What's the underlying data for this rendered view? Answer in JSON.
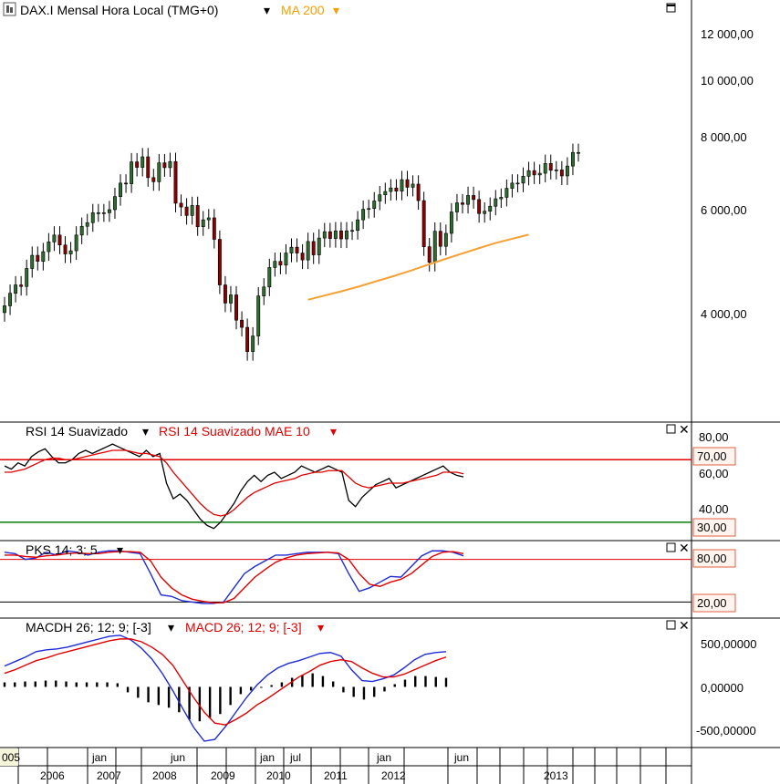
{
  "colors": {
    "up": "#2e6b2e",
    "down": "#8b0000",
    "ma": "#f5a033",
    "rsi": "#000000",
    "rsi_mae": "#e00000",
    "pks_k": "#1f2bd6",
    "pks_d": "#e00000",
    "macd": "#1f2bd6",
    "signal": "#e00000",
    "level_upper": "#e00000",
    "level_lower": "#0a7a0a"
  },
  "panels": {
    "price": {
      "title": "DAX.I Mensal Hora Local (TMG+0)",
      "overlay": "MA 200",
      "yticks": [
        "12 000,00",
        "10 000,00",
        "8 000,00",
        "6 000,00",
        "4 000,00"
      ]
    },
    "rsi": {
      "title": "RSI 14 Suavizado",
      "overlay": "RSI 14 Suavizado MAE 10",
      "yticks": [
        "80,00",
        "60,00",
        "40,00"
      ],
      "levels": [
        "70,00",
        "30,00"
      ]
    },
    "pks": {
      "title": "PKS 14; 3; 5",
      "levels": [
        "80,00",
        "20,00"
      ]
    },
    "macd": {
      "title": "MACDH 26; 12; 9; [-3]",
      "overlay": "MACD 26; 12; 9; [-3]",
      "yticks": [
        "500,00000",
        "0,00000",
        "-500,00000"
      ]
    }
  },
  "xaxis": {
    "top_labels": [
      "005",
      "jan",
      "jun",
      "jan",
      "jul",
      "jan",
      "jun"
    ],
    "years": [
      "2006",
      "2007",
      "2008",
      "2009",
      "2010",
      "2011",
      "2012",
      "2013"
    ]
  },
  "chart_data": [
    {
      "type": "candlestick",
      "title": "DAX.I Mensal Hora Local (TMG+0)",
      "scale": "log",
      "ylim": [
        3000,
        14000
      ],
      "x_range": [
        "2005-06",
        "2013-05"
      ],
      "close": [
        4590,
        4820,
        4980,
        4950,
        5310,
        5590,
        5460,
        5670,
        5890,
        6050,
        5820,
        5620,
        5690,
        6050,
        6260,
        6350,
        6600,
        6600,
        6600,
        6680,
        7030,
        7410,
        7390,
        8050,
        7880,
        8210,
        7570,
        7450,
        8020,
        7870,
        8060,
        6850,
        6750,
        6530,
        6790,
        6250,
        6420,
        6470,
        5950,
        4980,
        4640,
        4790,
        4340,
        4220,
        3840,
        4080,
        4770,
        4940,
        5330,
        5460,
        5380,
        5640,
        5770,
        5640,
        5490,
        5900,
        5600,
        5980,
        6130,
        5970,
        6150,
        5960,
        6150,
        6160,
        6420,
        6690,
        6710,
        6910,
        7080,
        7170,
        7270,
        7180,
        7510,
        7290,
        7380,
        6920,
        5780,
        5440,
        6140,
        5790,
        6090,
        6620,
        6860,
        6820,
        7060,
        6950,
        6580,
        6640,
        6770,
        6970,
        7010,
        7260,
        7410,
        7410,
        7610,
        7780,
        7650,
        7700,
        8000,
        7790,
        7800,
        7620,
        7920,
        8350,
        8350
      ],
      "open": [
        4470,
        4590,
        4820,
        4980,
        4950,
        5310,
        5590,
        5460,
        5670,
        5890,
        6050,
        5820,
        5620,
        5690,
        6050,
        6260,
        6350,
        6600,
        6600,
        6600,
        6680,
        7030,
        7410,
        7390,
        8050,
        7880,
        8210,
        7570,
        7450,
        8020,
        7870,
        8060,
        6850,
        6750,
        6530,
        6790,
        6250,
        6420,
        6470,
        5950,
        4980,
        4640,
        4790,
        4340,
        4220,
        3840,
        4080,
        4770,
        4940,
        5330,
        5460,
        5380,
        5640,
        5770,
        5640,
        5490,
        5900,
        5600,
        5980,
        6130,
        5970,
        6150,
        5960,
        6150,
        6160,
        6420,
        6690,
        6710,
        6910,
        7080,
        7170,
        7270,
        7180,
        7510,
        7290,
        7380,
        6920,
        5780,
        5440,
        6140,
        5790,
        6090,
        6620,
        6860,
        6820,
        7060,
        6950,
        6580,
        6640,
        6770,
        6970,
        7010,
        7260,
        7410,
        7410,
        7610,
        7780,
        7650,
        7700,
        8000,
        7790,
        7800,
        7620,
        7920,
        8350
      ]
    },
    {
      "type": "line",
      "name": "MA 200",
      "x_range": [
        "2010-01",
        "2013-05"
      ],
      "values": [
        4700,
        4780,
        4860,
        4950,
        5050,
        5150,
        5260,
        5380,
        5500,
        5620,
        5740,
        5860,
        5960,
        6060
      ]
    },
    {
      "type": "line",
      "title": "RSI 14 Suavizado",
      "ylim": [
        20,
        90
      ],
      "levels": [
        70,
        30
      ],
      "series": [
        {
          "name": "RSI 14 Suavizado",
          "values": [
            66,
            64,
            68,
            66,
            72,
            75,
            77,
            72,
            68,
            68,
            70,
            74,
            76,
            74,
            76,
            78,
            80,
            78,
            76,
            74,
            72,
            76,
            72,
            74,
            55,
            45,
            48,
            44,
            38,
            32,
            28,
            26,
            30,
            36,
            42,
            50,
            56,
            60,
            56,
            60,
            62,
            58,
            60,
            62,
            66,
            64,
            62,
            64,
            66,
            64,
            62,
            44,
            40,
            46,
            50,
            54,
            56,
            58,
            52,
            54,
            56,
            58,
            60,
            62,
            64,
            66,
            62,
            60,
            59
          ]
        },
        {
          "name": "RSI 14 Suavizado MAE 10",
          "values": [
            62,
            62,
            63,
            64,
            66,
            68,
            70,
            71,
            71,
            70,
            70,
            71,
            72,
            73,
            74,
            75,
            76,
            76,
            76,
            75,
            74,
            74,
            73,
            72,
            68,
            62,
            57,
            52,
            47,
            42,
            38,
            35,
            34,
            35,
            38,
            42,
            46,
            49,
            51,
            53,
            55,
            56,
            57,
            58,
            60,
            61,
            62,
            62,
            63,
            63,
            63,
            59,
            55,
            53,
            52,
            53,
            54,
            55,
            55,
            55,
            56,
            57,
            58,
            59,
            60,
            62,
            62,
            62,
            61
          ]
        }
      ]
    },
    {
      "type": "line",
      "title": "PKS 14; 3; 5",
      "ylim": [
        0,
        100
      ],
      "levels": [
        80,
        20
      ],
      "series": [
        {
          "name": "PKS 14; 3; 5",
          "values": [
            90,
            88,
            80,
            82,
            90,
            86,
            92,
            90,
            86,
            90,
            92,
            92,
            90,
            88,
            60,
            30,
            28,
            22,
            20,
            18,
            18,
            20,
            40,
            60,
            70,
            78,
            86,
            86,
            88,
            90,
            90,
            90,
            88,
            60,
            35,
            40,
            48,
            56,
            55,
            70,
            85,
            92,
            92,
            90,
            85
          ]
        },
        {
          "name": "PKS D",
          "values": [
            86,
            86,
            84,
            83,
            85,
            86,
            88,
            89,
            88,
            88,
            90,
            91,
            91,
            90,
            78,
            55,
            40,
            30,
            24,
            21,
            19,
            19,
            25,
            40,
            55,
            66,
            76,
            82,
            86,
            88,
            89,
            90,
            89,
            80,
            60,
            45,
            42,
            48,
            52,
            60,
            72,
            84,
            90,
            91,
            88
          ]
        }
      ]
    },
    {
      "type": "line",
      "title": "MACDH 26; 12; 9; [-3]",
      "ylim": [
        -650,
        700
      ],
      "series": [
        {
          "name": "MACD 26; 12; 9; [-3]",
          "values": [
            230,
            280,
            330,
            390,
            410,
            420,
            440,
            470,
            500,
            530,
            560,
            570,
            520,
            430,
            310,
            150,
            -40,
            -250,
            -450,
            -600,
            -580,
            -440,
            -280,
            -120,
            20,
            130,
            210,
            260,
            290,
            330,
            370,
            380,
            340,
            190,
            70,
            60,
            90,
            130,
            210,
            300,
            360,
            380,
            390
          ]
        },
        {
          "name": "MACD Signal",
          "values": [
            150,
            190,
            240,
            290,
            320,
            360,
            390,
            420,
            450,
            480,
            510,
            530,
            530,
            500,
            440,
            360,
            240,
            60,
            -120,
            -280,
            -400,
            -420,
            -360,
            -290,
            -200,
            -130,
            -50,
            30,
            110,
            170,
            240,
            280,
            300,
            280,
            210,
            150,
            110,
            110,
            140,
            190,
            240,
            290,
            330
          ]
        },
        {
          "name": "MACDH 26; 12; 9; [-3]",
          "values": [
            50,
            50,
            60,
            60,
            70,
            70,
            60,
            50,
            50,
            50,
            50,
            40,
            -60,
            -120,
            -170,
            -200,
            -230,
            -280,
            -360,
            -380,
            -340,
            -300,
            -200,
            -80,
            -40,
            -10,
            20,
            50,
            100,
            130,
            150,
            120,
            60,
            -60,
            -110,
            -140,
            -110,
            -50,
            30,
            80,
            120,
            120,
            110,
            100
          ]
        }
      ]
    }
  ]
}
